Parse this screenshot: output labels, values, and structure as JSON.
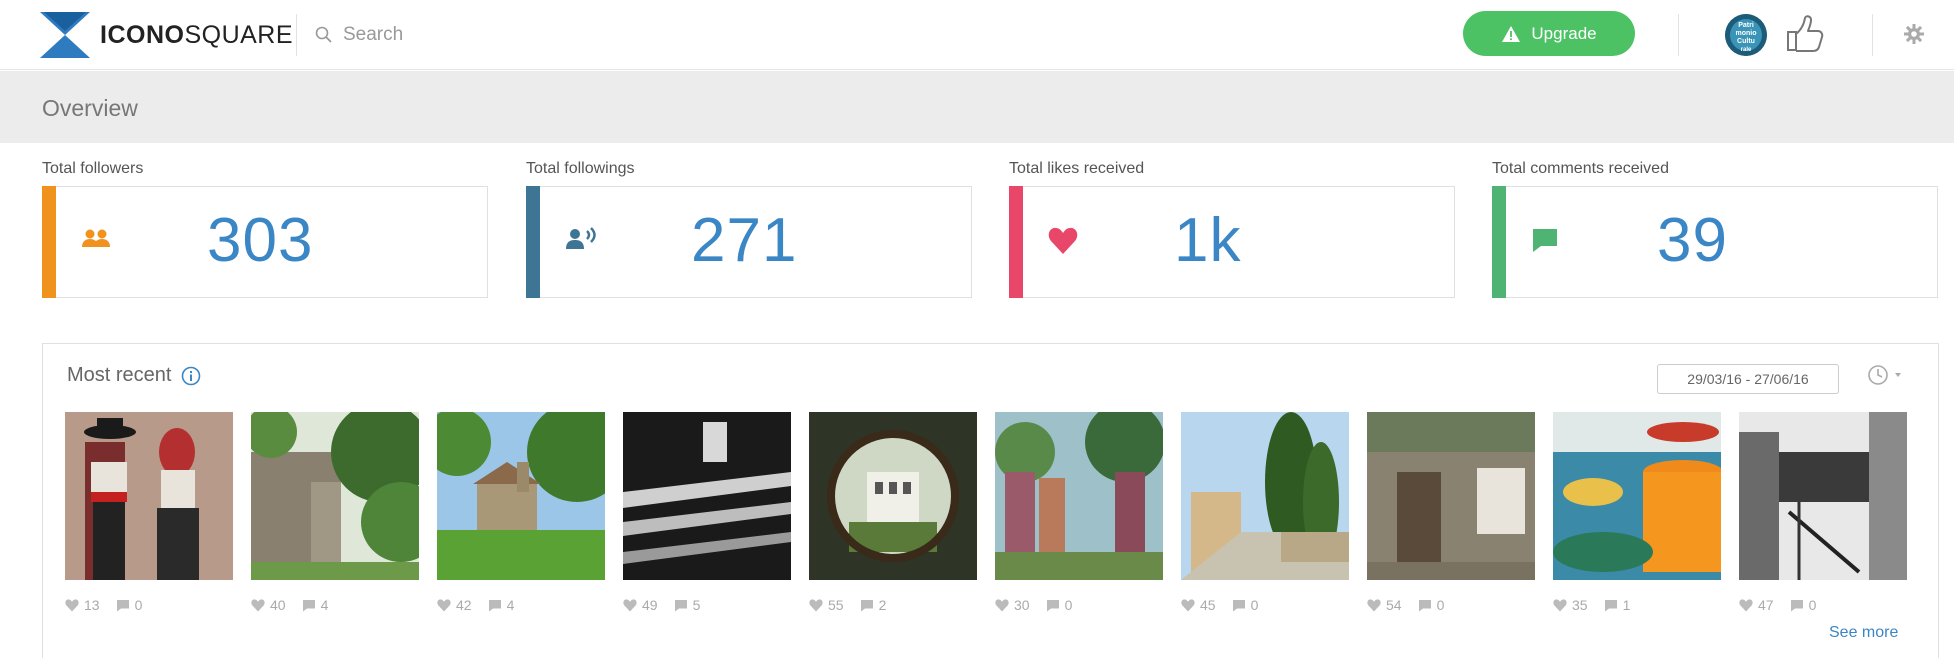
{
  "header": {
    "logo_bold": "ICONO",
    "logo_light": "SQUARE",
    "search_placeholder": "Search",
    "upgrade_label": "Upgrade",
    "avatar_text": "Patri monio Cultu rale"
  },
  "overview": {
    "title": "Overview"
  },
  "stats": [
    {
      "label": "Total followers",
      "value": "303",
      "color": "#f0921e",
      "icon": "followers-icon"
    },
    {
      "label": "Total followings",
      "value": "271",
      "color": "#3e7594",
      "icon": "followings-icon"
    },
    {
      "label": "Total likes received",
      "value": "1k",
      "color": "#e8476a",
      "icon": "heart-icon"
    },
    {
      "label": "Total comments received",
      "value": "39",
      "color": "#4fb374",
      "icon": "comment-icon"
    }
  ],
  "recent": {
    "title": "Most recent",
    "date_range": "29/03/16 - 27/06/16",
    "see_more": "See more",
    "photos": [
      {
        "likes": "13",
        "comments": "0",
        "scene": "costumes"
      },
      {
        "likes": "40",
        "comments": "4",
        "scene": "castle"
      },
      {
        "likes": "42",
        "comments": "4",
        "scene": "chapel"
      },
      {
        "likes": "49",
        "comments": "5",
        "scene": "church"
      },
      {
        "likes": "55",
        "comments": "2",
        "scene": "villa"
      },
      {
        "likes": "30",
        "comments": "0",
        "scene": "market"
      },
      {
        "likes": "45",
        "comments": "0",
        "scene": "street"
      },
      {
        "likes": "54",
        "comments": "0",
        "scene": "wall"
      },
      {
        "likes": "35",
        "comments": "1",
        "scene": "plates"
      },
      {
        "likes": "47",
        "comments": "0",
        "scene": "ruins"
      }
    ]
  }
}
